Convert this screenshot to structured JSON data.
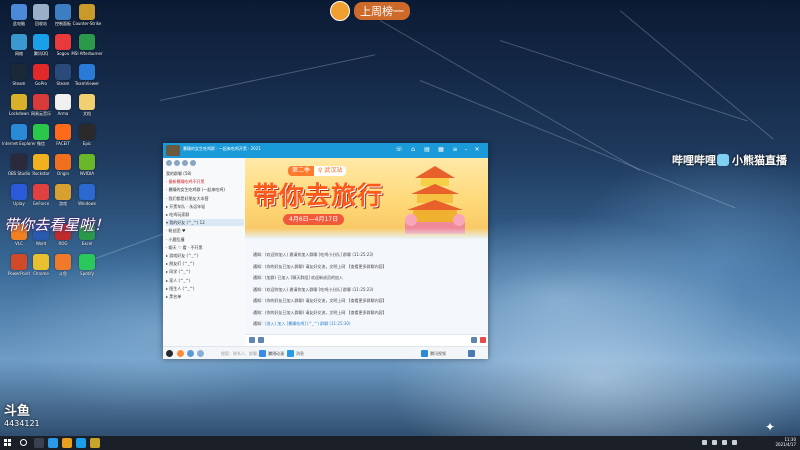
{
  "desktop": {
    "icons": [
      {
        "label": "此电脑",
        "color": "#4a8ad8"
      },
      {
        "label": "回收站",
        "color": "#9ab0c8"
      },
      {
        "label": "控制面板",
        "color": "#3c7ec2"
      },
      {
        "label": "Counter-Strike",
        "color": "#c89a2a"
      },
      {
        "label": "网络",
        "color": "#3a9ad0"
      },
      {
        "label": "腾讯QQ",
        "color": "#1aa0e8"
      },
      {
        "label": "Sogou",
        "color": "#e83a3a"
      },
      {
        "label": "MSI Afterburner",
        "color": "#2a9a4a"
      },
      {
        "label": "Steam",
        "color": "#1a2838"
      },
      {
        "label": "GoPro",
        "color": "#e02a2a"
      },
      {
        "label": "Steam",
        "color": "#2a4a7a"
      },
      {
        "label": "TeamViewer",
        "color": "#2a7ad8"
      },
      {
        "label": "Lockdown",
        "color": "#d8b02a"
      },
      {
        "label": "网易云音乐",
        "color": "#d83a3a"
      },
      {
        "label": "Arma",
        "color": "#f0f0f0"
      },
      {
        "label": "文档",
        "color": "#f0d070"
      },
      {
        "label": "Internet Explorer",
        "color": "#2a8ad8"
      },
      {
        "label": "微信",
        "color": "#2ac84a"
      },
      {
        "label": "FACEIT",
        "color": "#ff6a1a"
      },
      {
        "label": "Epic",
        "color": "#2a2a2a"
      },
      {
        "label": "OBS Studio",
        "color": "#2a2a3a"
      },
      {
        "label": "Rockstar",
        "color": "#f0b020"
      },
      {
        "label": "Origin",
        "color": "#f07020"
      },
      {
        "label": "NVIDIA",
        "color": "#6ab82a"
      },
      {
        "label": "Uplay",
        "color": "#2a5ad8"
      },
      {
        "label": "GeForce",
        "color": "#e04040"
      },
      {
        "label": "游戏",
        "color": "#d8a030"
      },
      {
        "label": "Windows",
        "color": "#2a6ad0"
      },
      {
        "label": "VLC",
        "color": "#f08020"
      },
      {
        "label": "Word",
        "color": "#2a5ab0"
      },
      {
        "label": "ROG",
        "color": "#c02a2a"
      },
      {
        "label": "Excel",
        "color": "#2a9a4a"
      },
      {
        "label": "PowerPoint",
        "color": "#d04a2a"
      },
      {
        "label": "Chrome",
        "color": "#e8c030"
      },
      {
        "label": "斗鱼",
        "color": "#f07a2a"
      },
      {
        "label": "Spotify",
        "color": "#2ac85a"
      }
    ]
  },
  "stream_overlay": {
    "streamer_badge": "上周榜一",
    "handwritten": "带你去看星啦！",
    "brand_left": "哔哩哔哩",
    "brand_right": "小熊猫直播",
    "douyu_logo": "斗鱼",
    "douyu_id": "4434121"
  },
  "qq_window": {
    "title": "暴躁的女生吃鸡群 · 一起来吃鸡开黑 · 2021",
    "controls": [
      "菜单",
      "最小化",
      "最大化",
      "关闭"
    ],
    "groups": [
      {
        "text": "我的群聊 (58)",
        "style": "normal"
      },
      {
        "text": "· 最新暴躁吃鸡不开黑",
        "style": "red"
      },
      {
        "text": "· 暴躁的女生吃鸡群 (一起来吃鸡)",
        "style": "normal"
      },
      {
        "text": "· 我们都是好朋友大本营",
        "style": "normal"
      },
      {
        "text": "▸ 开黑车队 · 永远年轻",
        "style": "normal"
      },
      {
        "text": "▸ 吃鸡玩家群",
        "style": "normal"
      },
      {
        "text": "▾ 我的好友 (^_^) 12",
        "style": "sel"
      },
      {
        "text": "   · 粉丝团 ♥",
        "style": "normal"
      },
      {
        "text": "   · 小鹿乱撞",
        "style": "normal"
      },
      {
        "text": "   · 聊天 ♡ 看 · 不开黑",
        "style": "normal"
      },
      {
        "text": "▸ 游戏好友 (^_^)",
        "style": "normal"
      },
      {
        "text": "▸ 朋友们 (^_^)",
        "style": "normal"
      },
      {
        "text": "▸ 同学 (^_^)",
        "style": "normal"
      },
      {
        "text": "▸ 家人 (^_^)",
        "style": "normal"
      },
      {
        "text": "▸ 陌生人 (^_^)",
        "style": "normal"
      },
      {
        "text": "▸ 黑名单",
        "style": "normal"
      }
    ],
    "banner": {
      "season_a": "第二季",
      "season_b": "♀ 武汉站",
      "title": "带你去旅行",
      "date": "4月6日—4月17日"
    },
    "messages": [
      {
        "prefix": "通知：",
        "text": "(欢迎你加入) 邀请你加入群聊 [吃鸡小分队] 群聊 (11:25:23)"
      },
      {
        "prefix": "通知：",
        "text": "(你的好友已加入群聊) 请友好交流，文明上网 【查看更多群聊内容】"
      },
      {
        "prefix": "通知：",
        "text": "(加群) 已加入 [聊天群组] 欢迎新成员的加入"
      },
      {
        "prefix": "通知：",
        "text": "(欢迎你加入) 邀请你加入群聊 [吃鸡小分队] 群聊 (11:25:23)"
      },
      {
        "prefix": "通知：",
        "text": "(你的好友已加入群聊) 请友好交流，文明上网 【查看更多群聊内容】"
      },
      {
        "prefix": "通知：",
        "text": "(你的好友已加入群聊) 请友好交流，文明上网 【查看更多群聊内容】"
      },
      {
        "prefix": "通知：",
        "text": "(进入) 加入 [暴躁吃鸡] (^_^) 群聊 (11:25:30)"
      }
    ],
    "footer": {
      "search_placeholder": "搜索：联系人、群聊、群、文件",
      "item_a": "腾讯动漫",
      "item_b": "消息",
      "item_c": "腾讯视频"
    }
  },
  "taskbar": {
    "time": "11:30",
    "date": "2021/4/17"
  }
}
